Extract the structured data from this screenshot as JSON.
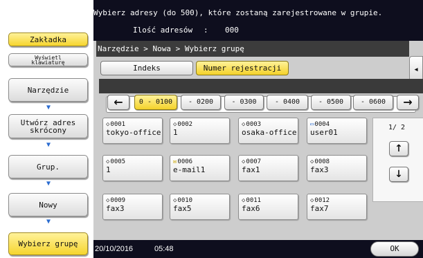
{
  "header": {
    "instruction": "Wybierz adresy (do 500), które zostaną zarejestrowane w grupie.",
    "count_label": "Ilość adresów",
    "count_separator": ":",
    "count_value": "000"
  },
  "left_panel": {
    "tab_label": "Zakładka",
    "keyboard_label_1": "Wyświetl",
    "keyboard_label_2": "klawiaturę",
    "steps": [
      {
        "label": "Narzędzie"
      },
      {
        "label_1": "Utwórz adres",
        "label_2": "skrócony"
      },
      {
        "label": "Grup."
      },
      {
        "label": "Nowy"
      },
      {
        "label": "Wybierz grupę"
      }
    ]
  },
  "main": {
    "breadcrumb": "Narzędzie > Nowa > Wybierz grupę",
    "side_tab_icon": "double-chevron-left-icon",
    "tabs": [
      {
        "label": "Indeks",
        "active": false
      },
      {
        "label": "Numer rejestracji",
        "active": true
      }
    ],
    "ranges": [
      "0 - 0100",
      "- 0200",
      "- 0300",
      "- 0400",
      "- 0500",
      "- 0600"
    ],
    "range_prev": "←",
    "range_next": "→",
    "entries": [
      {
        "num": "0001",
        "name": "tokyo-office",
        "icon": "fax-icon"
      },
      {
        "num": "0002",
        "name": "1",
        "icon": "fax-icon"
      },
      {
        "num": "0003",
        "name": "osaka-office",
        "icon": "fax-icon"
      },
      {
        "num": "0004",
        "name": "user01",
        "icon": "pc-icon"
      },
      {
        "num": "0005",
        "name": "1",
        "icon": "fax-icon"
      },
      {
        "num": "0006",
        "name": "e-mail1",
        "icon": "email-icon"
      },
      {
        "num": "0007",
        "name": "fax1",
        "icon": "fax-icon"
      },
      {
        "num": "0008",
        "name": "fax3",
        "icon": "fax-icon"
      },
      {
        "num": "0009",
        "name": "fax3",
        "icon": "fax-icon"
      },
      {
        "num": "0010",
        "name": "fax5",
        "icon": "fax-icon"
      },
      {
        "num": "0011",
        "name": "fax6",
        "icon": "fax-icon"
      },
      {
        "num": "0012",
        "name": "fax7",
        "icon": "fax-icon"
      }
    ],
    "page_indicator": "1/ 2",
    "page_up": "↑",
    "page_down": "↓"
  },
  "status": {
    "date": "20/10/2016",
    "time": "05:48",
    "ok_label": "OK"
  },
  "colors": {
    "accent_yellow": "#f4d22a",
    "dark_bar": "#0e0e1e",
    "panel_gray": "#cdcdcd",
    "arrow_blue": "#2b6cd0"
  }
}
